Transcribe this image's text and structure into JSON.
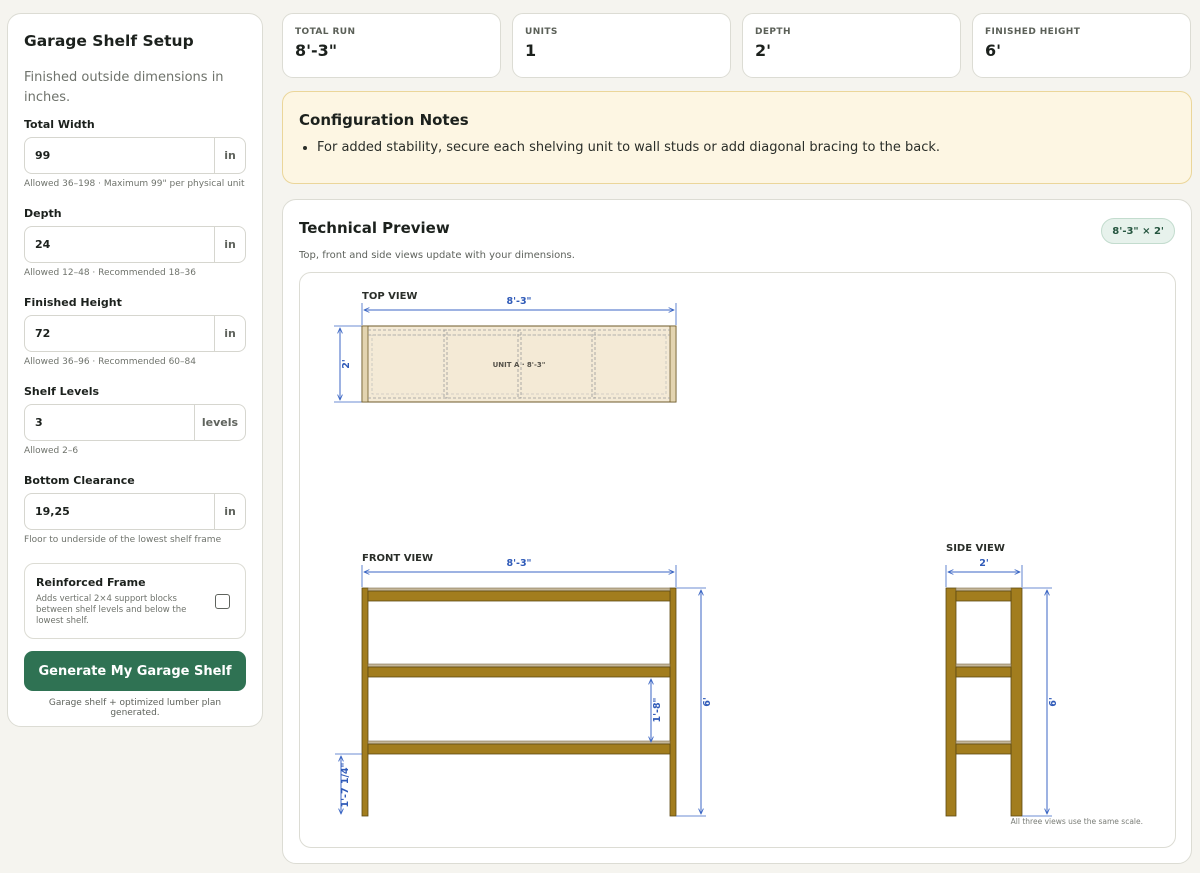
{
  "sidebar": {
    "title": "Garage Shelf Setup",
    "description": "Finished outside dimensions in inches.",
    "fields": [
      {
        "label": "Total Width",
        "value": "99",
        "unit": "in",
        "hint": "Allowed 36–198 · Maximum 99\" per physical unit"
      },
      {
        "label": "Depth",
        "value": "24",
        "unit": "in",
        "hint": "Allowed 12–48 · Recommended 18–36"
      },
      {
        "label": "Finished Height",
        "value": "72",
        "unit": "in",
        "hint": "Allowed 36–96 · Recommended 60–84"
      },
      {
        "label": "Shelf Levels",
        "value": "3",
        "unit": "levels",
        "hint": "Allowed 2–6"
      },
      {
        "label": "Bottom Clearance",
        "value": "19,25",
        "unit": "in",
        "hint": "Floor to underside of the lowest shelf frame"
      }
    ],
    "reinforced": {
      "title": "Reinforced Frame",
      "description": "Adds vertical 2×4 support blocks between shelf levels and below the lowest shelf.",
      "checked": false
    },
    "generate_label": "Generate My Garage Shelf",
    "status": "Garage shelf + optimized lumber plan generated."
  },
  "stats": [
    {
      "label": "TOTAL RUN",
      "value": "8'-3\""
    },
    {
      "label": "UNITS",
      "value": "1"
    },
    {
      "label": "DEPTH",
      "value": "2'"
    },
    {
      "label": "FINISHED HEIGHT",
      "value": "6'"
    }
  ],
  "notes": {
    "title": "Configuration Notes",
    "items": [
      "For added stability, secure each shelving unit to wall studs or add diagonal bracing to the back."
    ]
  },
  "preview": {
    "title": "Technical Preview",
    "subtitle": "Top, front and side views update with your dimensions.",
    "badge": "8'-3\" × 2'",
    "scale_note": "All three views use the same scale.",
    "top_view": {
      "label": "TOP VIEW",
      "width_dim": "8'-3\"",
      "depth_dim": "2'",
      "unit_label": "UNIT A · 8'-3\""
    },
    "front_view": {
      "label": "FRONT VIEW",
      "width_dim": "8'-3\"",
      "height_dim": "6'",
      "spacing_dim": "1'-8\"",
      "clearance_dim": "1'-7 1/4\""
    },
    "side_view": {
      "label": "SIDE VIEW",
      "depth_dim": "2'",
      "height_dim": "6'"
    }
  },
  "colors": {
    "accent": "#2f7253",
    "wood": "#a27d1e",
    "wood_dark": "#5e4a12",
    "dimension": "#3b66c4",
    "notes_bg": "#fdf6e3"
  }
}
